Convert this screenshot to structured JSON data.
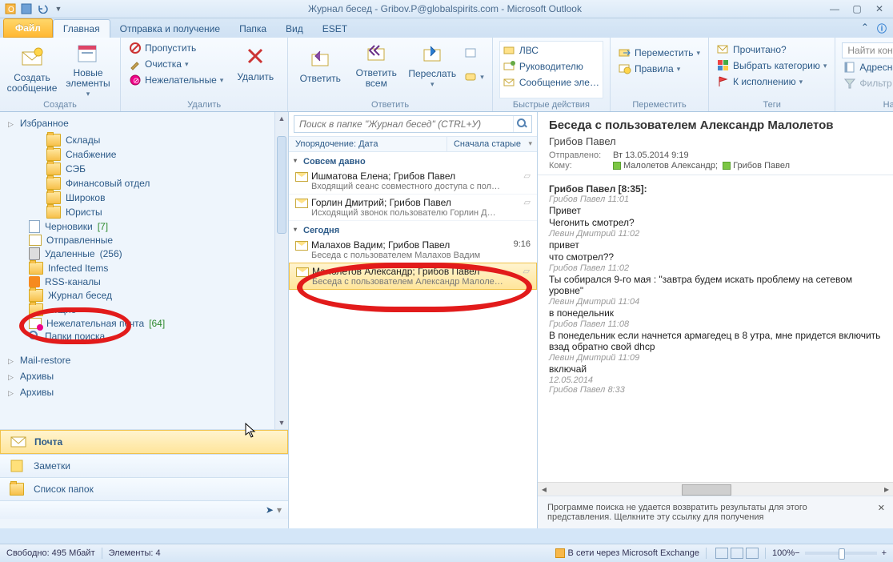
{
  "window": {
    "title": "Журнал бесед - Gribov.P@globalspirits.com - Microsoft Outlook"
  },
  "tabs": {
    "file": "Файл",
    "items": [
      "Главная",
      "Отправка и получение",
      "Папка",
      "Вид",
      "ESET"
    ],
    "active": 0
  },
  "ribbon": {
    "new": {
      "btn1": "Создать сообщение",
      "btn2": "Новые элементы",
      "label": "Создать"
    },
    "delete": {
      "ignore": "Пропустить",
      "clean": "Очистка",
      "junk": "Нежелательные",
      "del": "Удалить",
      "label": "Удалить"
    },
    "respond": {
      "reply": "Ответить",
      "replyall": "Ответить всем",
      "forward": "Переслать",
      "label": "Ответить"
    },
    "quick": {
      "i1": "ЛВС",
      "i2": "Руководителю",
      "i3": "Сообщение эле…",
      "label": "Быстрые действия"
    },
    "move": {
      "move": "Переместить",
      "rules": "Правила",
      "label": "Переместить"
    },
    "tags": {
      "read": "Прочитано?",
      "cat": "Выбрать категорию",
      "flag": "К исполнению",
      "label": "Теги"
    },
    "find": {
      "placeholder": "Найти контакт",
      "ab": "Адресная книга",
      "filter": "Фильтр почты",
      "label": "Найти"
    }
  },
  "nav": {
    "fav": "Избранное",
    "folders": [
      {
        "name": "Склады",
        "lvl": 2
      },
      {
        "name": "Снабжение",
        "lvl": 2
      },
      {
        "name": "СЭБ",
        "lvl": 2
      },
      {
        "name": "Финансовый отдел",
        "lvl": 2
      },
      {
        "name": "Широков",
        "lvl": 2
      },
      {
        "name": "Юристы",
        "lvl": 2
      },
      {
        "name": "Черновики",
        "lvl": 1,
        "count": "[7]",
        "cc": "green",
        "icon": "draft"
      },
      {
        "name": "Отправленные",
        "lvl": 1,
        "icon": "sent"
      },
      {
        "name": "Удаленные",
        "lvl": 1,
        "count": "(256)",
        "cc": "blue",
        "icon": "trash"
      },
      {
        "name": "Infected Items",
        "lvl": 1
      },
      {
        "name": "RSS-каналы",
        "lvl": 1,
        "icon": "rss"
      },
      {
        "name": "Журнал бесед",
        "lvl": 1,
        "current": true
      },
      {
        "name": "…щие",
        "lvl": 1,
        "partial": true
      },
      {
        "name": "Нежелательная почта",
        "lvl": 1,
        "count": "[64]",
        "cc": "green",
        "icon": "junk"
      },
      {
        "name": "Папки поиска",
        "lvl": 1,
        "icon": "search"
      }
    ],
    "sections": [
      "Mail-restore",
      "Архивы",
      "Архивы"
    ],
    "modules": {
      "mail": "Почта",
      "notes": "Заметки",
      "folders": "Список папок"
    }
  },
  "msglist": {
    "search_ph": "Поиск в папке \"Журнал бесед\" (CTRL+У)",
    "arrange_left": "Упорядочение: Дата",
    "arrange_right": "Сначала старые",
    "groups": [
      {
        "title": "Совсем давно",
        "msgs": [
          {
            "from": "Ишматова Елена; Грибов Павел",
            "subj": "Входящий сеанс совместного доступа с пол…"
          },
          {
            "from": "Горлин Дмитрий; Грибов Павел",
            "subj": "Исходящий звонок пользователю Горлин Д…"
          }
        ]
      },
      {
        "title": "Сегодня",
        "msgs": [
          {
            "from": "Малахов Вадим; Грибов Павел",
            "subj": "Беседа с пользователем Малахов Вадим",
            "time": "9:16"
          },
          {
            "from": "Малолетов Александр; Грибов Павел",
            "subj": "Беседа с пользователем Александр Малоле…",
            "selected": true
          }
        ]
      }
    ]
  },
  "reading": {
    "subject": "Беседа с пользователем Александр Малолетов",
    "from": "Грибов Павел",
    "sent_lbl": "Отправлено:",
    "sent": "Вт 13.05.2014 9:19",
    "to_lbl": "Кому:",
    "to": [
      "Малолетов Александр;",
      "Грибов Павел"
    ],
    "chat": [
      {
        "t": "hdr",
        "v": "Грибов Павел  [8:35]:"
      },
      {
        "t": "meta",
        "v": "Грибов Павел 11:01"
      },
      {
        "t": "line",
        "v": "Привет"
      },
      {
        "t": "line",
        "v": "Чегонить смотрел?"
      },
      {
        "t": "meta",
        "v": "Левин Дмитрий 11:02"
      },
      {
        "t": "line",
        "v": "привет"
      },
      {
        "t": "line",
        "v": "что смотрел??"
      },
      {
        "t": "meta",
        "v": "Грибов Павел 11:02"
      },
      {
        "t": "line",
        "v": "Ты собирался 9-го мая : \"завтра будем искать проблему на сетевом уровне\""
      },
      {
        "t": "meta",
        "v": "Левин Дмитрий 11:04"
      },
      {
        "t": "line",
        "v": "в понедельник"
      },
      {
        "t": "meta",
        "v": "Грибов Павел 11:08"
      },
      {
        "t": "line",
        "v": "В понедельник если начнется армагедец в 8 утра, мне придется включить взад обратно свой dhcp"
      },
      {
        "t": "meta",
        "v": "Левин Дмитрий 11:09"
      },
      {
        "t": "line",
        "v": "включай"
      },
      {
        "t": "meta",
        "v": "12.05.2014"
      },
      {
        "t": "meta",
        "v": "Грибов Павел 8:33"
      }
    ],
    "info": "Программе поиска не удается возвратить результаты для этого представления. Щелкните эту ссылку для получения"
  },
  "status": {
    "free": "Свободно: 495 Мбайт",
    "items": "Элементы: 4",
    "conn": "В сети через Microsoft Exchange",
    "zoom": "100%"
  }
}
